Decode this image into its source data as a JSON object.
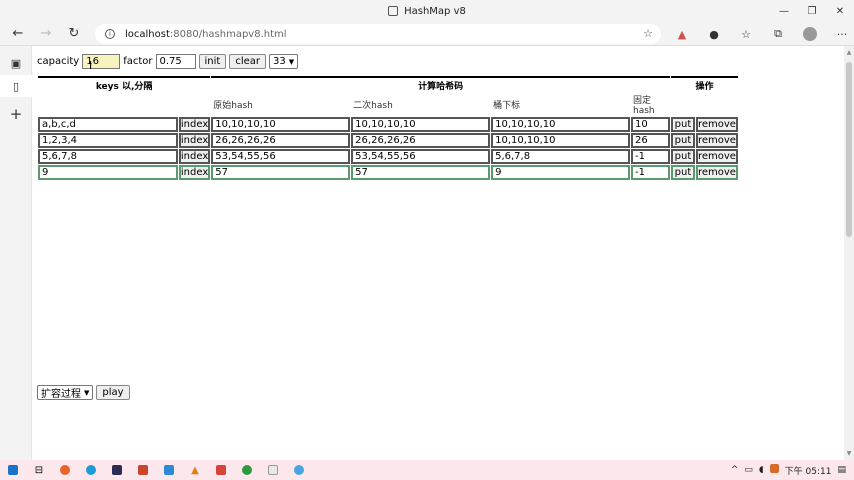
{
  "window": {
    "title": "HashMap v8",
    "controls": [
      "—",
      "❐",
      "✕"
    ]
  },
  "address": {
    "host": "localhost",
    "path": ":8080/hashmapv8.html"
  },
  "controls": {
    "capacity_label": "capacity",
    "capacity_value": "16",
    "factor_label": "factor",
    "factor_value": "0.75",
    "init_label": "init",
    "clear_label": "clear",
    "select_value": "33"
  },
  "table": {
    "headers": {
      "keys": "keys 以,分隔",
      "compute": "计算哈希码",
      "ops": "操作"
    },
    "subheaders": {
      "raw_hash": "原始hash",
      "second_hash": "二次hash",
      "bucket": "桶下标",
      "fixed_hash": "固定hash"
    },
    "index_label": "index",
    "put_label": "put",
    "remove_label": "remove",
    "rows": [
      {
        "keys": "a,b,c,d",
        "raw": "10,10,10,10",
        "second": "10,10,10,10",
        "bucket": "10,10,10,10",
        "fixed": "10"
      },
      {
        "keys": "1,2,3,4",
        "raw": "26,26,26,26",
        "second": "26,26,26,26",
        "bucket": "10,10,10,10",
        "fixed": "26"
      },
      {
        "keys": "5,6,7,8",
        "raw": "53,54,55,56",
        "second": "53,54,55,56",
        "bucket": "5,6,7,8",
        "fixed": "-1"
      },
      {
        "keys": "9",
        "raw": "57",
        "second": "57",
        "bucket": "9",
        "fixed": "-1"
      }
    ]
  },
  "replay": {
    "select_value": "扩容过程",
    "play_label": "play"
  },
  "tray": {
    "time": "下午 05:11"
  }
}
